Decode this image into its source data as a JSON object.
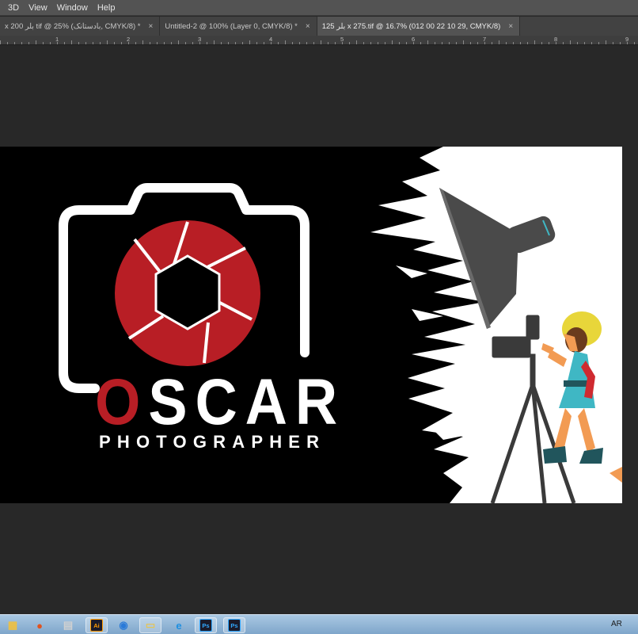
{
  "menu": [
    "3D",
    "View",
    "Window",
    "Help"
  ],
  "tabs": [
    {
      "label": "x 200 بلر tif @ 25% (بادستانک, CMYK/8) *",
      "close": "×"
    },
    {
      "label": "Untitled-2 @ 100% (Layer 0, CMYK/8) *",
      "close": "×"
    },
    {
      "label": "125 بلر x 275.tif @ 16.7% (012 00 22 10 29, CMYK/8)",
      "close": "×"
    }
  ],
  "ruler": {
    "numbers": [
      "1",
      "2",
      "3",
      "4",
      "5",
      "6",
      "7",
      "8",
      "9"
    ]
  },
  "artwork": {
    "title_first": "O",
    "title_rest": "SCAR",
    "subtitle": "PHOTOGRAPHER",
    "colors": {
      "accent_red": "#b81e25",
      "background": "#000000",
      "white": "#ffffff",
      "hat": "#e8d63a",
      "dress": "#3fb7c4",
      "skin": "#f29b53",
      "gray": "#4a4a4a"
    }
  },
  "taskbar": {
    "items": [
      {
        "icon": "windows-explorer-icon",
        "glyph": "▦",
        "color": "#f0c040"
      },
      {
        "icon": "firefox-icon",
        "glyph": "●",
        "color": "#e0531f"
      },
      {
        "icon": "calculator-icon",
        "glyph": "▤",
        "color": "#d0d0d0"
      },
      {
        "icon": "illustrator-icon",
        "glyph": "Ai",
        "color": "#ff9a00"
      },
      {
        "icon": "chrome-icon",
        "glyph": "◉",
        "color": "#2a7ad8"
      },
      {
        "icon": "folder-icon",
        "glyph": "▭",
        "color": "#e3c45a"
      },
      {
        "icon": "internet-explorer-icon",
        "glyph": "e",
        "color": "#1e8fe0"
      },
      {
        "icon": "photoshop-icon",
        "glyph": "Ps",
        "color": "#31a8ff"
      },
      {
        "icon": "photoshop-icon-2",
        "glyph": "Ps",
        "color": "#31a8ff"
      }
    ],
    "lang": "AR"
  }
}
